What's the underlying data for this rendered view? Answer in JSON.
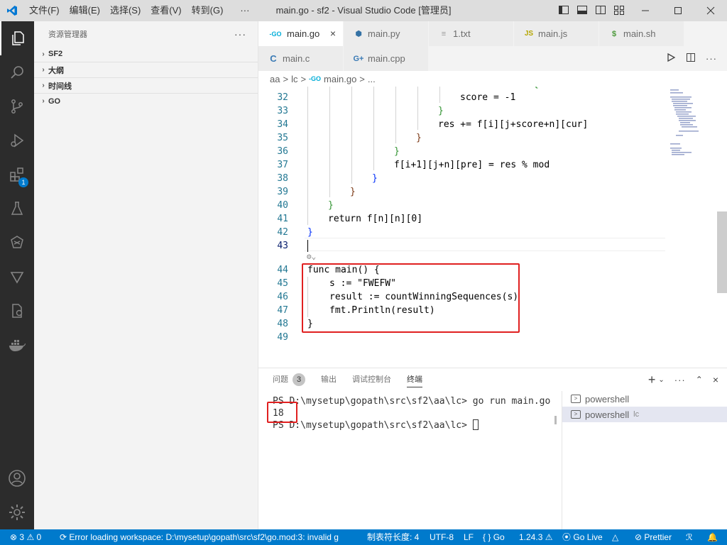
{
  "titlebar": {
    "title": "main.go - sf2 - Visual Studio Code [管理员]",
    "menu": [
      "文件(F)",
      "编辑(E)",
      "选择(S)",
      "查看(V)",
      "转到(G)",
      "···"
    ]
  },
  "activitybar": {
    "extensions_badge": "1"
  },
  "sidebar": {
    "title": "资源管理器",
    "more": "···",
    "sections": [
      "SF2",
      "大纲",
      "时间线",
      "GO"
    ]
  },
  "tabs_row1": [
    {
      "label": "main.go",
      "icon": "go-icon",
      "icon_text": "-GO",
      "active": true
    },
    {
      "label": "main.py",
      "icon": "python-icon",
      "icon_text": "⬢"
    },
    {
      "label": "1.txt",
      "icon": "text-file-icon",
      "icon_text": "≡"
    },
    {
      "label": "main.js",
      "icon": "js-icon",
      "icon_text": "JS"
    },
    {
      "label": "main.sh",
      "icon": "shell-icon",
      "icon_text": "$"
    }
  ],
  "tabs_row2": [
    {
      "label": "main.c",
      "icon": "c-icon",
      "icon_text": "C"
    },
    {
      "label": "main.cpp",
      "icon": "cpp-icon",
      "icon_text": "G+"
    }
  ],
  "breadcrumb": [
    "aa",
    ">",
    "lc",
    ">",
    "main.go",
    ">",
    "..."
  ],
  "code": {
    "lines": [
      {
        "n": "32",
        "text": "score = -1"
      },
      {
        "n": "33",
        "text": "}"
      },
      {
        "n": "34",
        "text": "res += f[i][j+score+n][cur]"
      },
      {
        "n": "35",
        "text": "}"
      },
      {
        "n": "36",
        "text": "}"
      },
      {
        "n": "37",
        "text": "f[i+1][j+n][pre] = res % mod"
      },
      {
        "n": "38",
        "text": "}"
      },
      {
        "n": "39",
        "text": "}"
      },
      {
        "n": "40",
        "text": "}"
      },
      {
        "n": "41",
        "text": "return f[n][n][0]"
      },
      {
        "n": "42",
        "text": "}"
      },
      {
        "n": "43",
        "text": ""
      },
      {
        "n": "44",
        "text": "func main() {"
      },
      {
        "n": "45",
        "text": "s := \"FWEFW\""
      },
      {
        "n": "46",
        "text": "result := countWinningSequences(s)"
      },
      {
        "n": "47",
        "text": "fmt.Println(result)"
      },
      {
        "n": "48",
        "text": "}"
      },
      {
        "n": "49",
        "text": ""
      }
    ]
  },
  "panel": {
    "tabs": [
      "问题",
      "输出",
      "调试控制台",
      "终端"
    ],
    "problems_count": "3",
    "active_tab": "终端",
    "terminal_lines": [
      "PS D:\\mysetup\\gopath\\src\\sf2\\aa\\lc> go run main.go",
      "18",
      "PS D:\\mysetup\\gopath\\src\\sf2\\aa\\lc> "
    ],
    "terminals": [
      {
        "name": "powershell",
        "sub": ""
      },
      {
        "name": "powershell",
        "sub": "lc"
      }
    ]
  },
  "statusbar": {
    "errors": "3",
    "warnings": "0",
    "message": "Error loading workspace: D:\\mysetup\\gopath\\src\\sf2\\go.mod:3: invalid g",
    "indent": "制表符长度: 4",
    "encoding": "UTF-8",
    "eol": "LF",
    "language": "Go",
    "go_version": "1.24.3",
    "golive": "Go Live",
    "prettier": "Prettier"
  },
  "colors": {
    "accent": "#007acc",
    "highlight_box": "#e02020",
    "activity_bar": "#2c2c2c"
  }
}
